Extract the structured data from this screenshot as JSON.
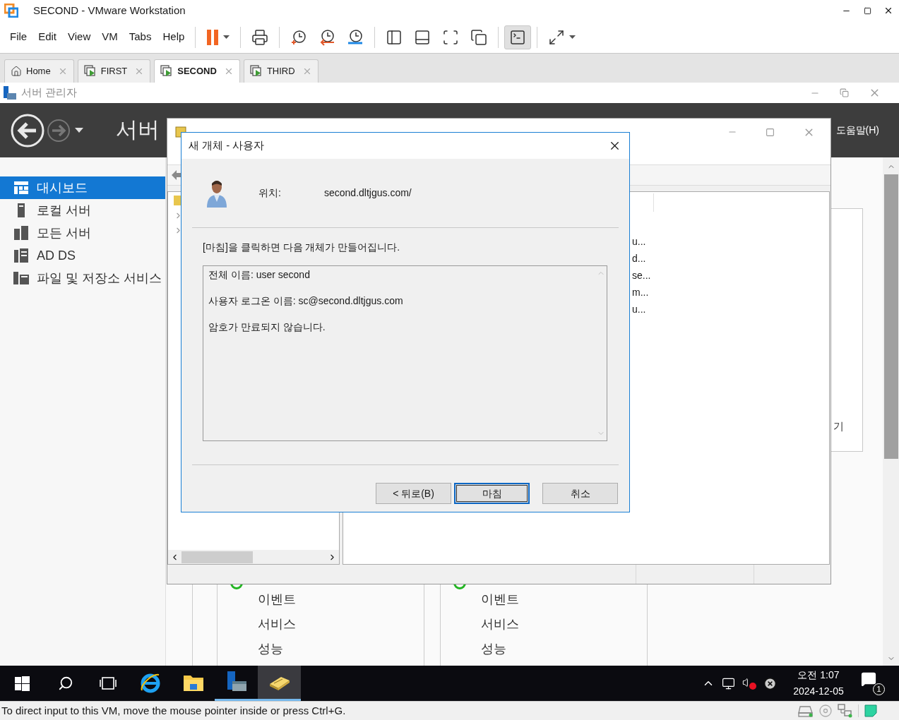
{
  "window": {
    "title": "SECOND - VMware Workstation"
  },
  "menu": [
    "File",
    "Edit",
    "View",
    "VM",
    "Tabs",
    "Help"
  ],
  "toolbar": [
    {
      "kind": "pause",
      "selected": false
    },
    {
      "kind": "ctrl_alt_del",
      "selected": false
    },
    {
      "kind": "snapshot_take",
      "selected": false
    },
    {
      "kind": "snapshot_revert",
      "selected": false
    },
    {
      "kind": "snapshot_manage",
      "selected": false
    },
    {
      "kind": "view_library",
      "selected": false
    },
    {
      "kind": "view_thumbnail",
      "selected": false
    },
    {
      "kind": "full_screen",
      "selected": false
    },
    {
      "kind": "unity",
      "selected": false
    },
    {
      "kind": "console",
      "selected": true
    },
    {
      "kind": "stretch",
      "selected": false
    }
  ],
  "tabs": [
    {
      "label": "Home",
      "kind": "home",
      "selected": false
    },
    {
      "label": "FIRST",
      "kind": "vm",
      "selected": false
    },
    {
      "label": "SECOND",
      "kind": "vm",
      "selected": true
    },
    {
      "label": "THIRD",
      "kind": "vm",
      "selected": false
    }
  ],
  "server_manager": {
    "title": "서버 관리자",
    "header": "서버",
    "help_menu": "도움말(H)",
    "nav": [
      {
        "label": "대시보드",
        "kind": "dashboard",
        "selected": true
      },
      {
        "label": "로컬 서버",
        "kind": "server",
        "selected": false
      },
      {
        "label": "모든 서버",
        "kind": "servers",
        "selected": false
      },
      {
        "label": "AD DS",
        "kind": "adds",
        "selected": false
      },
      {
        "label": "파일 및 저장소 서비스",
        "kind": "storage",
        "selected": false
      }
    ],
    "side_panel_text": "기",
    "tiles": [
      {
        "items": [
          "이벤트",
          "서비스",
          "성능"
        ]
      },
      {
        "items": [
          "이벤트",
          "서비스",
          "성능"
        ]
      }
    ]
  },
  "ad_window": {
    "list_fragments": [
      "u...",
      "d...",
      "se...",
      "m...",
      "u..."
    ]
  },
  "dialog": {
    "title": "새 개체 - 사용자",
    "location_label": "위치:",
    "location": "second.dltjgus.com/",
    "instruction": "[마침]을 클릭하면 다음 개체가 만들어집니다.",
    "summary": [
      "전체 이름: user second",
      "사용자 로그온 이름: sc@second.dltjgus.com",
      "암호가 만료되지 않습니다."
    ],
    "buttons": [
      {
        "label": "< 뒤로(B)",
        "default": false
      },
      {
        "label": "마침",
        "default": true
      },
      {
        "label": "취소",
        "default": false
      }
    ]
  },
  "taskbar": {
    "apps": [
      {
        "kind": "browser",
        "running": false,
        "selected": false
      },
      {
        "kind": "explorer",
        "running": false,
        "selected": false
      },
      {
        "kind": "server_manager",
        "running": true,
        "selected": false
      },
      {
        "kind": "ad_tool",
        "running": true,
        "selected": true
      }
    ],
    "time": "오전 1:07",
    "date": "2024-12-05",
    "notification_count": "1"
  },
  "status_bar": {
    "text": "To direct input to this VM, move the mouse pointer inside or press Ctrl+G."
  }
}
